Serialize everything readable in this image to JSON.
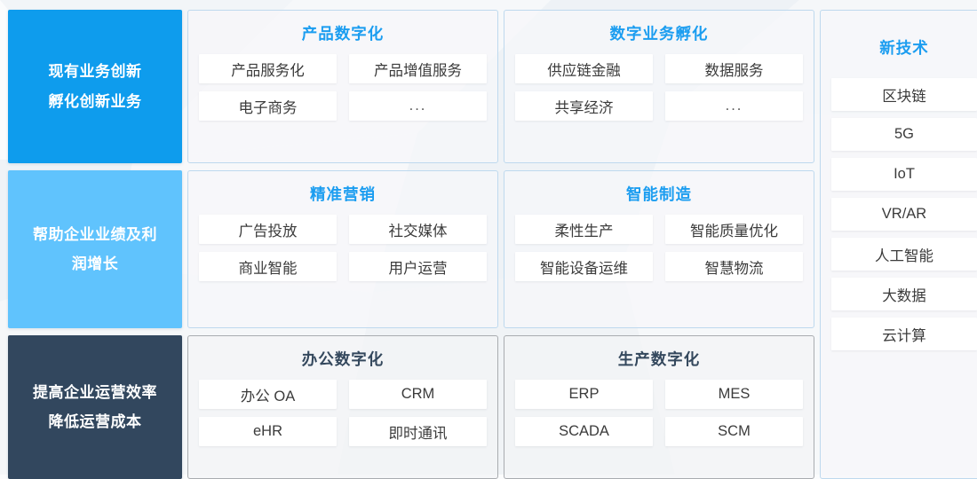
{
  "theme": {
    "background": "#fbfcfd",
    "accent_blue": "#1b9df0",
    "card_blue": "#0e9ced",
    "card_light_blue": "#60c3fd",
    "card_navy": "#32475e",
    "panel_border_blue": "#bed9ee",
    "panel_border_gray": "#a9acb0",
    "tile_text": "#3b3b3b"
  },
  "rows": [
    {
      "label": {
        "lines": [
          "现有业务创新",
          "孵化创新业务"
        ],
        "color": "#0e9ced",
        "name": "row-label-innovation"
      },
      "panels": [
        {
          "title": "产品数字化",
          "style": "blue",
          "tiles": [
            "产品服务化",
            "产品增值服务",
            "电子商务",
            "..."
          ]
        },
        {
          "title": "数字业务孵化",
          "style": "blue",
          "tiles": [
            "供应链金融",
            "数据服务",
            "共享经济",
            "..."
          ]
        }
      ]
    },
    {
      "label": {
        "lines": [
          "帮助企业业绩及利",
          "润增长"
        ],
        "color": "#60c3fd",
        "name": "row-label-growth"
      },
      "panels": [
        {
          "title": "精准营销",
          "style": "blue",
          "tiles": [
            "广告投放",
            "社交媒体",
            "商业智能",
            "用户运营"
          ]
        },
        {
          "title": "智能制造",
          "style": "blue",
          "tiles": [
            "柔性生产",
            "智能质量优化",
            "智能设备运维",
            "智慧物流"
          ]
        }
      ]
    },
    {
      "label": {
        "lines": [
          "提高企业运营效率",
          "降低运营成本"
        ],
        "color": "#32475e",
        "name": "row-label-efficiency"
      },
      "panels": [
        {
          "title": "办公数字化",
          "style": "gray",
          "tiles": [
            "办公 OA",
            "CRM",
            "eHR",
            "即时通讯"
          ]
        },
        {
          "title": "生产数字化",
          "style": "gray",
          "tiles": [
            "ERP",
            "MES",
            "SCADA",
            "SCM"
          ]
        }
      ]
    }
  ],
  "tech_panel": {
    "title": "新技术",
    "items": [
      "区块链",
      "5G",
      "IoT",
      "VR/AR",
      "人工智能",
      "大数据",
      "云计算"
    ]
  }
}
